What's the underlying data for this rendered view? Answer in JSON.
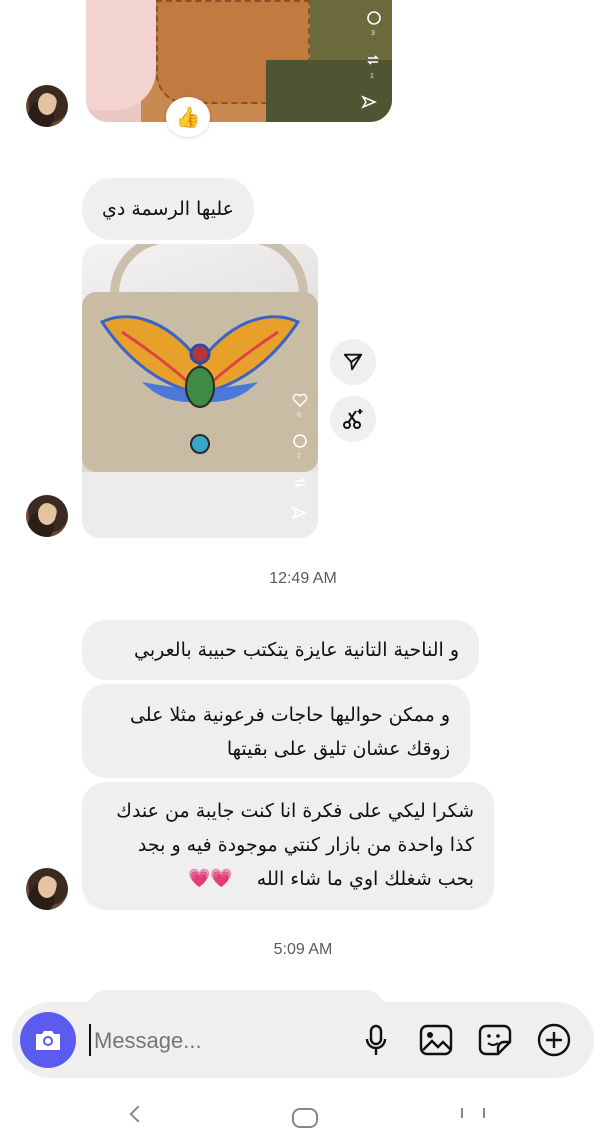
{
  "messages": [
    {
      "id": "m1",
      "text": "عليها الرسمة دي"
    },
    {
      "id": "m2",
      "text": "و الناحية التانية عايزة يتكتب حبيبة بالعربي"
    },
    {
      "id": "m3",
      "text": "و ممكن حواليها حاجات فرعونية مثلا على\nزوقك عشان تليق على بقيتها"
    },
    {
      "id": "m4",
      "text": "شكرا ليكي على فكرة انا كنت جايبة من عندك\nكذا واحدة من بازار كنتي موجودة فيه و بجد\nبحب شغلك اوي ما شاء الله"
    }
  ],
  "hearts_emoji": "💗💗",
  "reaction_emoji": "👍",
  "timestamps": {
    "t1": "12:49 AM",
    "t2": "5:09 AM"
  },
  "reel_counts": {
    "top_comments": "3",
    "top_reposts": "1",
    "likes": "6",
    "comments": "2"
  },
  "composer": {
    "placeholder": "Message..."
  },
  "colors": {
    "accent": "#5b5bf0",
    "bubble": "#efefef"
  }
}
